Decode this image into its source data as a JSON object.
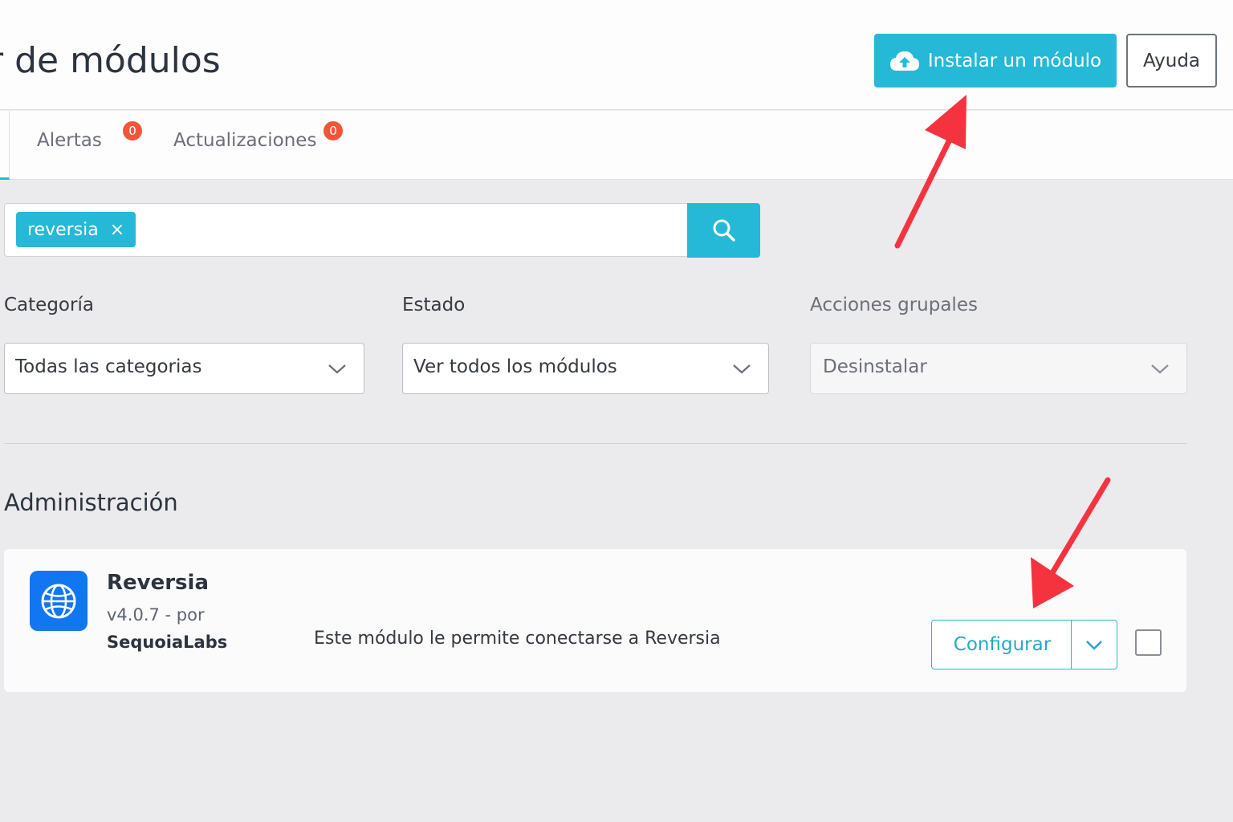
{
  "header": {
    "title": "r de módulos",
    "install_button": "Instalar un módulo",
    "help_button": "Ayuda",
    "install_icon": "cloud-upload-icon"
  },
  "tabs": [
    {
      "label": "Alertas",
      "badge": "0"
    },
    {
      "label": "Actualizaciones",
      "badge": "0"
    }
  ],
  "search": {
    "tag": "reversia",
    "tag_close": "×",
    "search_icon": "search-icon"
  },
  "filters": {
    "category_label": "Categoría",
    "category_value": "Todas las categorias",
    "state_label": "Estado",
    "state_value": "Ver todos los módulos",
    "bulk_label": "Acciones grupales",
    "bulk_value": "Desinstalar"
  },
  "section": {
    "title": "Administración"
  },
  "module": {
    "name": "Reversia",
    "version": "v4.0.7 - por",
    "author": "SequoiaLabs",
    "description": "Este módulo le permite conectarse a Reversia",
    "configure_button": "Configurar",
    "logo_icon": "globe-icon"
  },
  "colors": {
    "primary": "#25b9d7",
    "badge": "#f3553a",
    "annotation_arrow": "#f5333f",
    "module_logo": "#1176f2"
  }
}
